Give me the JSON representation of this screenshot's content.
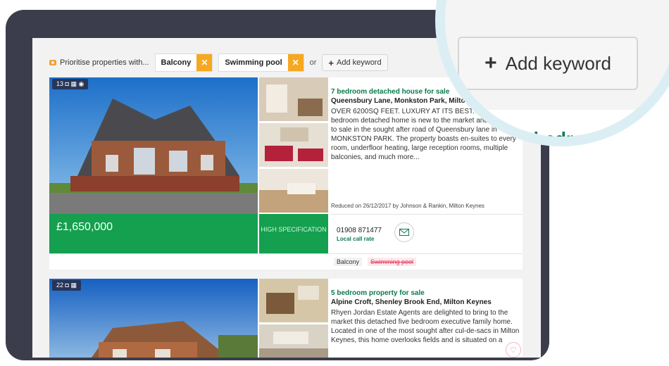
{
  "filter": {
    "prefix": "Prioritise properties with...",
    "chips": [
      {
        "label": "Balcony"
      },
      {
        "label": "Swimming pool"
      }
    ],
    "remove_glyph": "✕",
    "or_text": "or",
    "add_keyword": "Add keyword"
  },
  "listings": [
    {
      "photo_count": "13",
      "title": "7 bedroom detached house for sale",
      "address": "Queensbury Lane, Monkston Park, Milton Keynes",
      "description": "OVER 6200SQ FEET. LUXURY AT ITS BEST. This 7/8 bedroom detached home is new to the market and is brought to sale in the sought after road of Queensbury lane in MONKSTON PARK. The property boasts en-suites to every room, underfloor heating, large reception rooms, multiple balconies, and much more...",
      "reduced": "Reduced on 26/12/2017 by Johnson & Rankin, Milton Keynes",
      "price": "£1,650,000",
      "feature_tag": "HIGH SPECIFICATION",
      "phone": "01908 871477",
      "call_rate": "Local call rate",
      "keywords": [
        {
          "label": "Balcony",
          "matched": true
        },
        {
          "label": "Swimming pool",
          "matched": false
        }
      ]
    },
    {
      "photo_count": "22",
      "title": "5 bedroom property for sale",
      "address": "Alpine Croft, Shenley Brook End, Milton Keynes",
      "description": "Rhyen Jordan Estate Agents are delighted to bring to the market this detached five bedroom executive family home. Located in one of the most sought after cul-de-sacs in Milton Keynes, this home overlooks fields and is situated on a"
    }
  ],
  "zoom": {
    "add_keyword": "Add keyword",
    "title_fragment": "7 bedroom"
  },
  "colors": {
    "accent_green": "#14a04f",
    "title_green": "#0a7a4b",
    "chip_orange": "#f6a821",
    "frame": "#3c3d4c",
    "zoom_ring": "#dbeef3"
  }
}
